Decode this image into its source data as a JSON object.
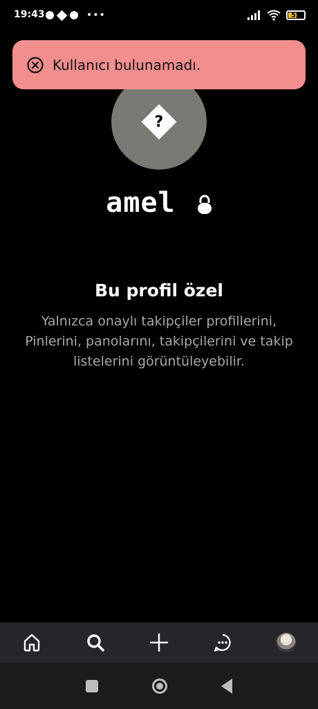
{
  "status_bar": {
    "time": "19:43",
    "battery_level": "52",
    "notification_icons": [
      "soccer-ball-icon",
      "box-icon",
      "soccer-ball-icon"
    ]
  },
  "toast": {
    "message": "Kullanıcı bulunamadı.",
    "background": "#f28e8e",
    "icon": "error-circle-icon"
  },
  "profile": {
    "username": "amel",
    "avatar_placeholder": "?",
    "locked": true
  },
  "private_notice": {
    "title": "Bu profil özel",
    "description": "Yalnızca onaylı takipçiler profillerini, Pinlerini, panolarını, takipçilerini ve takip listelerini görüntüleyebilir."
  },
  "bottom_nav": {
    "items": [
      "home-icon",
      "search-icon",
      "create-plus-icon",
      "messages-icon",
      "profile-avatar"
    ]
  },
  "system_nav": {
    "items": [
      "recents-button",
      "home-button",
      "back-button"
    ]
  }
}
